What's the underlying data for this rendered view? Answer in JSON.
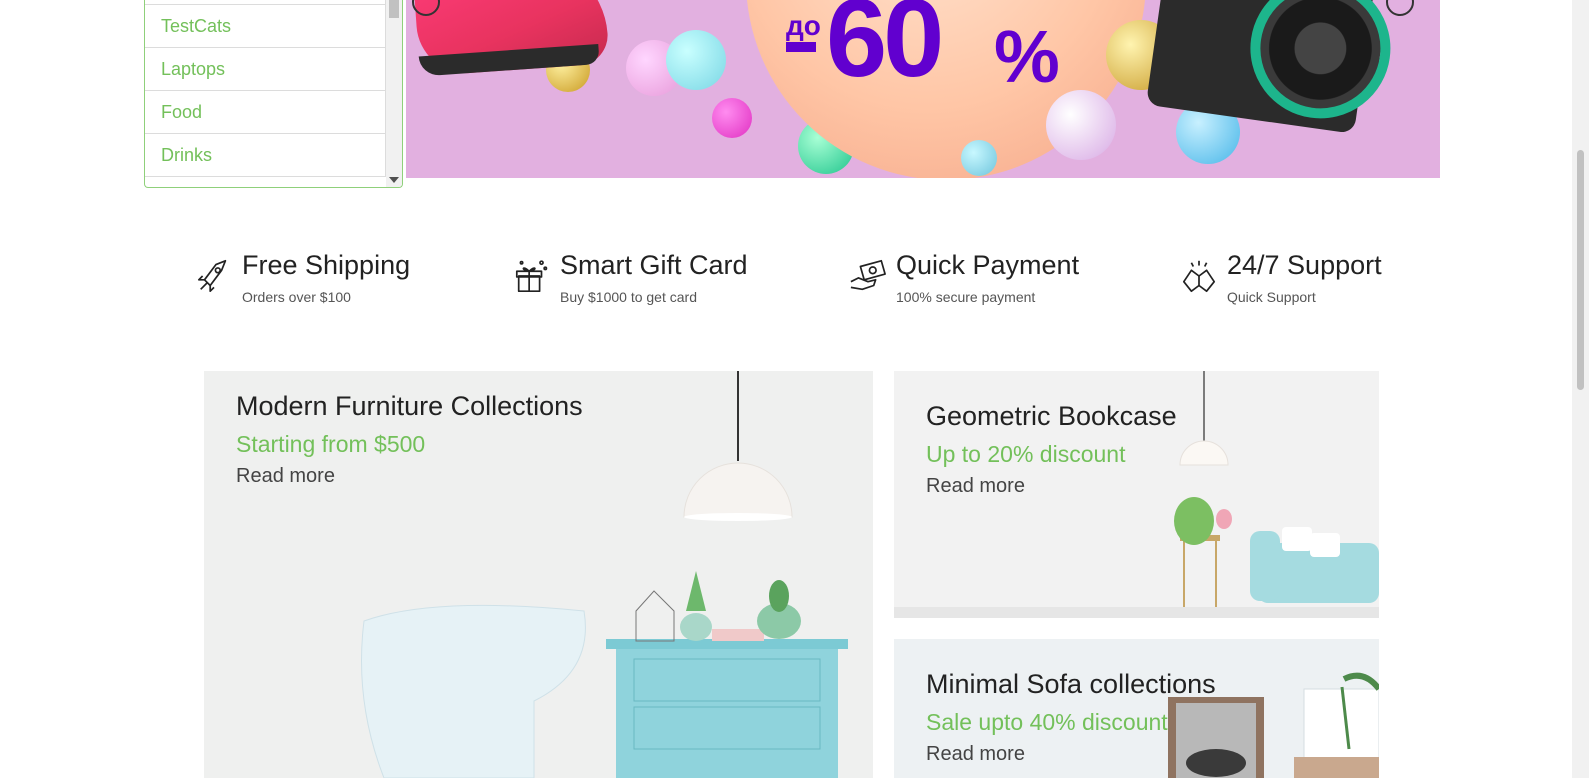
{
  "categories": {
    "items": [
      {
        "label": "TestCats"
      },
      {
        "label": "Laptops"
      },
      {
        "label": "Food"
      },
      {
        "label": "Drinks"
      }
    ]
  },
  "hero": {
    "prefix": "до",
    "number": "60",
    "percent": "%",
    "accent_color": "#6100cf",
    "background_color": "#e2b0e0"
  },
  "features": [
    {
      "title": "Free Shipping",
      "subtitle": "Orders over $100",
      "icon": "rocket-icon"
    },
    {
      "title": "Smart Gift Card",
      "subtitle": "Buy $1000 to get card",
      "icon": "gift-icon"
    },
    {
      "title": "Quick Payment",
      "subtitle": "100% secure payment",
      "icon": "money-hand-icon"
    },
    {
      "title": "24/7 Support",
      "subtitle": "Quick Support",
      "icon": "handshake-icon"
    }
  ],
  "promos": [
    {
      "title": "Modern Furniture Collections",
      "subtitle": "Starting from $500",
      "link": "Read more"
    },
    {
      "title": "Geometric Bookcase",
      "subtitle": "Up to 20% discount",
      "link": "Read more"
    },
    {
      "title": "Minimal Sofa collections",
      "subtitle": "Sale upto 40% discount",
      "link": "Read more"
    }
  ],
  "colors": {
    "accent_green": "#73c05a",
    "text_dark": "#222222"
  }
}
